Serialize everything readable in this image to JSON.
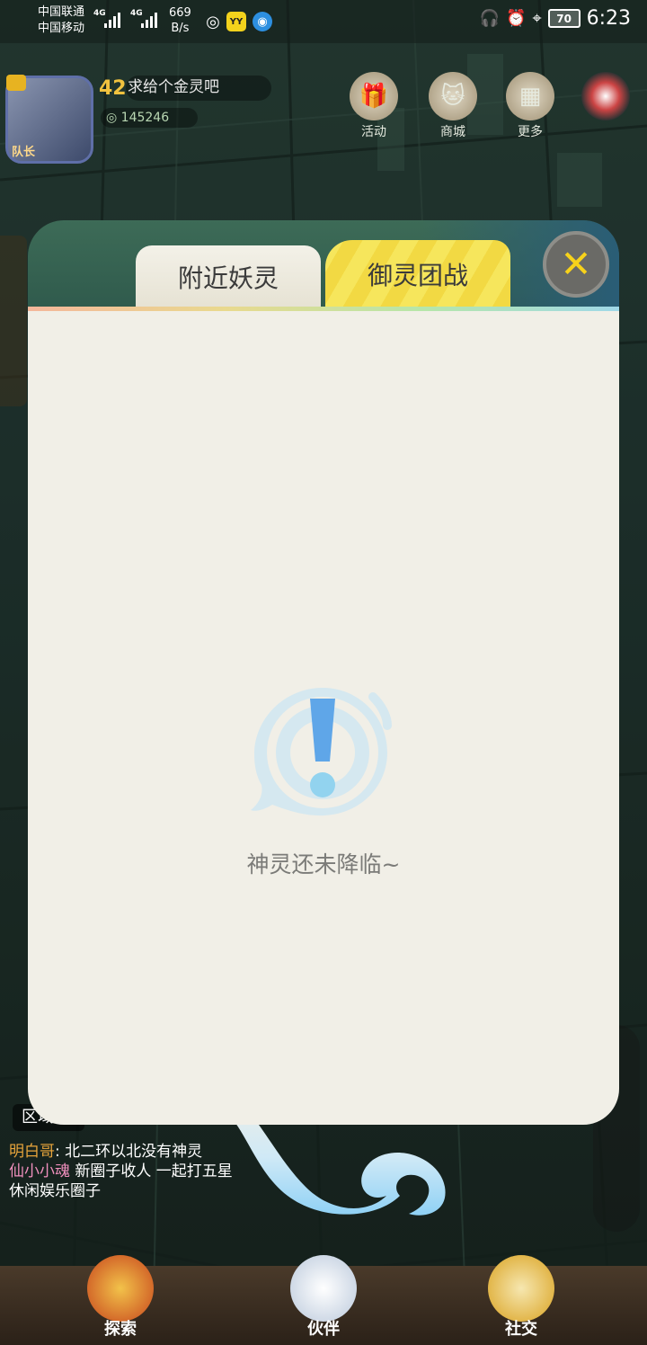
{
  "status_bar": {
    "carrier1": "中国联通",
    "carrier2": "中国移动",
    "net1": "4G",
    "net2": "4G",
    "speed_value": "669",
    "speed_unit": "B/s",
    "app1_label": "YY",
    "battery": "70",
    "time": "6:23"
  },
  "hud": {
    "level": "42",
    "message": "求给个金灵吧",
    "coins": "145246",
    "avatar_caption": "队长",
    "buttons": [
      {
        "label": "活动",
        "icon": "gift-icon"
      },
      {
        "label": "商城",
        "icon": "shop-icon"
      },
      {
        "label": "更多",
        "icon": "grid-icon"
      }
    ]
  },
  "modal": {
    "tabs": [
      {
        "label": "附近妖灵",
        "active": false
      },
      {
        "label": "御灵团战",
        "active": true
      }
    ],
    "empty_message": "神灵还未降临~"
  },
  "chat": {
    "zone_badge": "区域",
    "lines": [
      {
        "name": "明白哥",
        "text": "北二环以北没有神灵"
      },
      {
        "name": "仙小小魂",
        "text": "新圈子收人 一起打五星"
      },
      {
        "name": "",
        "text": "休闲娱乐圈子"
      }
    ]
  },
  "nav": {
    "items": [
      {
        "label": "探索"
      },
      {
        "label": "伙伴"
      },
      {
        "label": "社交"
      }
    ]
  },
  "colors": {
    "tab_active": "#f6e65c",
    "modal_body": "#f1efe7",
    "close_x": "#f7d21a"
  }
}
